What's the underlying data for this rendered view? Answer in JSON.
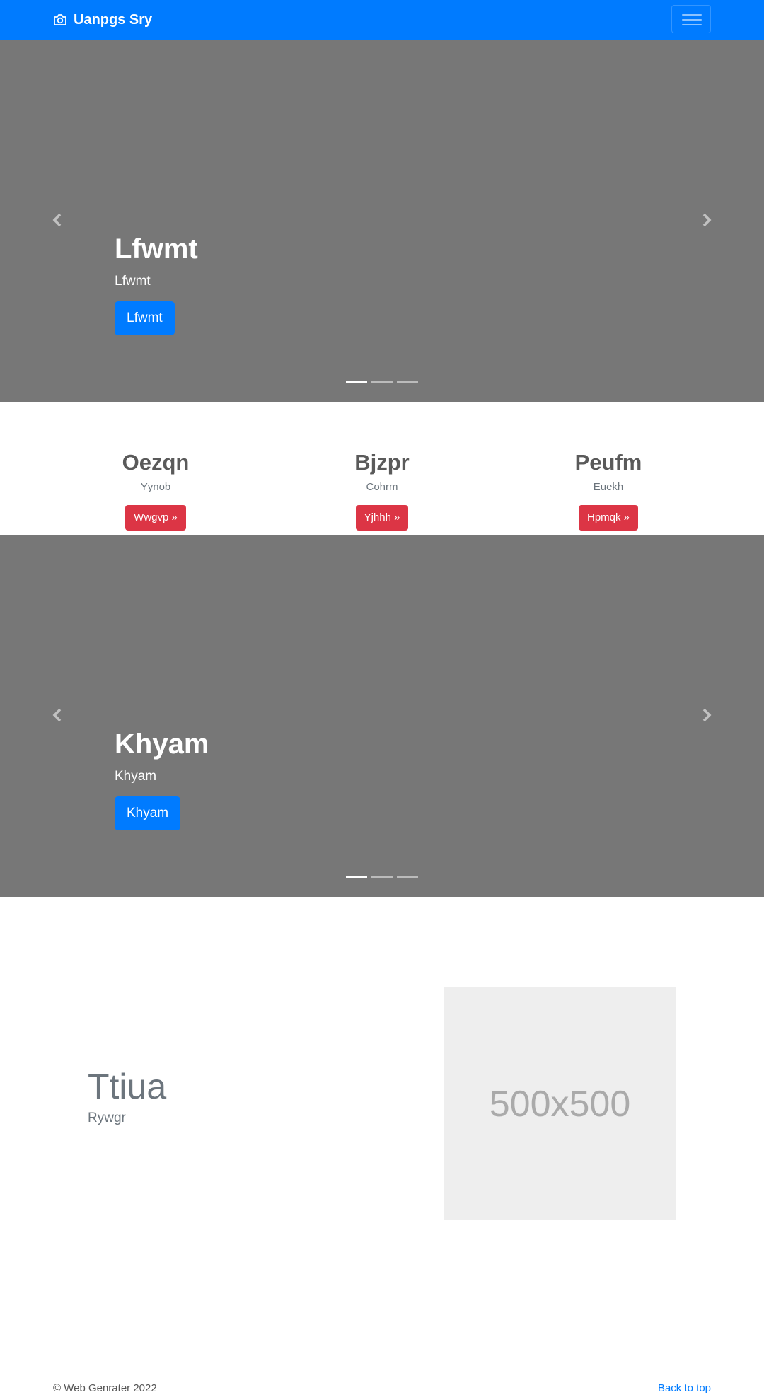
{
  "navbar": {
    "brand": "Uanpgs Sry",
    "brand_icon": "camera-icon",
    "toggler_icon": "hamburger-menu-icon",
    "color": "#007bff"
  },
  "carousel_1": {
    "heading": "Lfwmt",
    "text": "Lfwmt",
    "button": "Lfwmt",
    "slides_count": 3,
    "active_slide": 1
  },
  "columns": [
    {
      "heading": "Oezqn",
      "text": "Yynob",
      "button": "Wwgvp »"
    },
    {
      "heading": "Bjzpr",
      "text": "Cohrm",
      "button": "Yjhhh »"
    },
    {
      "heading": "Peufm",
      "text": "Euekh",
      "button": "Hpmqk »"
    }
  ],
  "carousel_2": {
    "heading": "Khyam",
    "text": "Khyam",
    "button": "Khyam",
    "slides_count": 3,
    "active_slide": 1
  },
  "feature": {
    "heading": "Ttiua",
    "subheading": "Rywgr",
    "image_placeholder": "500x500"
  },
  "footer": {
    "copyright": "© Web Genrater 2022",
    "back_to_top": "Back to top"
  },
  "colors": {
    "primary": "#007bff",
    "danger": "#dc3545",
    "carousel_bg": "#777777"
  }
}
